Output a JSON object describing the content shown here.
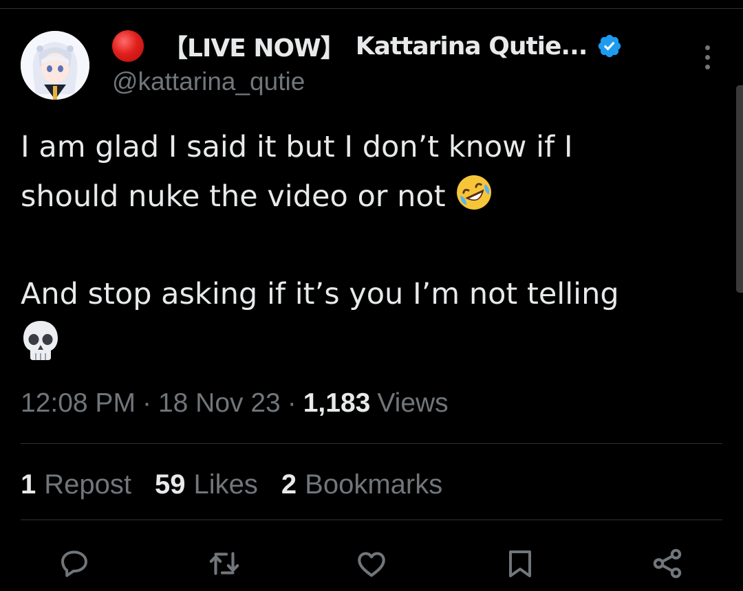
{
  "tweet": {
    "author": {
      "live_prefix": "【LIVE NOW】",
      "display_name": "Kattarina Qutie...",
      "handle": "@kattarina_qutie",
      "verified": true,
      "live_indicator_icon": "red-circle-emoji"
    },
    "text_lines": [
      "I am glad I said it but I don’t know if I",
      "should nuke the video or not",
      "",
      "And stop asking if it’s you I’m not telling",
      ""
    ],
    "emojis": [
      "rolling-on-the-floor-laughing",
      "skull"
    ],
    "time": "12:08 PM",
    "separator": "·",
    "date": "18 Nov 23",
    "views_count": "1,183",
    "views_label": "Views",
    "stats": {
      "reposts_count": "1",
      "reposts_label": "Repost",
      "likes_count": "59",
      "likes_label": "Likes",
      "bookmarks_count": "2",
      "bookmarks_label": "Bookmarks"
    },
    "actions": [
      "reply-icon",
      "repost-icon",
      "like-icon",
      "bookmark-icon",
      "share-icon"
    ]
  },
  "colors": {
    "background": "#000000",
    "primary_text": "#e7e9ea",
    "secondary_text": "#71767b",
    "divider": "#2f3336",
    "verified_blue": "#1d9bf0",
    "live_red": "#e0201b"
  }
}
